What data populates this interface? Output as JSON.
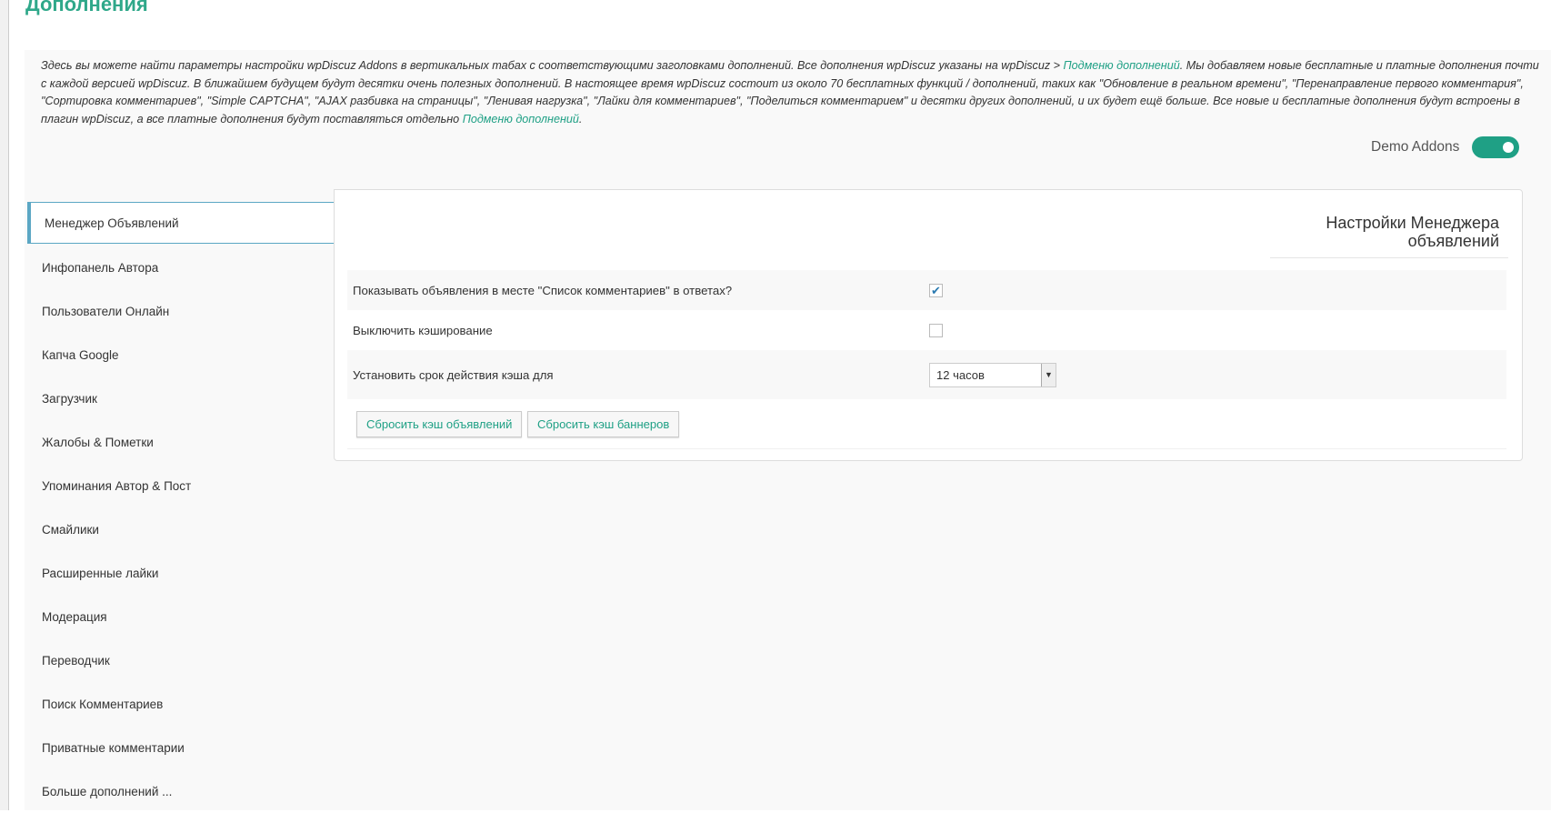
{
  "page_title": "Дополнения",
  "intro": {
    "part1": "Здесь вы можете найти параметры настройки wpDiscuz Addons в вертикальных табах с соответствующими заголовками дополнений. Все дополнения wpDiscuz указаны на wpDiscuz > ",
    "link1": "Подменю дополнений",
    "part2": ". Мы добавляем новые бесплатные и платные дополнения почти с каждой версией wpDiscuz. В ближайшем будущем будут десятки очень полезных дополнений. В настоящее время wpDiscuz состоит из около 70 бесплатных функций / дополнений, таких как \"Обновление в реальном времени\", \"Перенаправление первого комментария\", \"Сортировка комментариев\", \"Simple CAPTCHA\", \"AJAX разбивка на страницы\", \"Ленивая нагрузка\", \"Лайки для комментариев\", \"Поделиться комментарием\" и десятки других дополнений, и их будет ещё больше. Все новые и бесплатные дополнения будут встроены в плагин wpDiscuz, а все платные дополнения будут поставляться отдельно ",
    "link2": "Подменю дополнений",
    "part3": "."
  },
  "demo_addons": {
    "label": "Demo Addons",
    "enabled": true
  },
  "sidebar": {
    "items": [
      {
        "label": "Менеджер Объявлений"
      },
      {
        "label": "Инфопанель Автора"
      },
      {
        "label": "Пользователи Онлайн"
      },
      {
        "label": "Капча Google"
      },
      {
        "label": "Загрузчик"
      },
      {
        "label": "Жалобы & Пометки"
      },
      {
        "label": "Упоминания Автор & Пост"
      },
      {
        "label": "Смайлики"
      },
      {
        "label": "Расширенные лайки"
      },
      {
        "label": "Модерация"
      },
      {
        "label": "Переводчик"
      },
      {
        "label": "Поиск Комментариев"
      },
      {
        "label": "Приватные комментарии"
      },
      {
        "label": "Больше дополнений ..."
      }
    ]
  },
  "panel": {
    "heading": "Настройки Менеджера объявлений",
    "settings": [
      {
        "label": "Показывать объявления в месте \"Список комментариев\" в ответах?",
        "checked": true
      },
      {
        "label": "Выключить кэширование",
        "checked": false
      },
      {
        "label": "Установить срок действия кэша для",
        "value": "12 часов"
      }
    ],
    "buttons": {
      "reset_ads": "Сбросить кэш объявлений",
      "reset_banners": "Сбросить кэш баннеров"
    }
  },
  "colors": {
    "accent": "#1fa085",
    "active_tab_border": "#5ba7c4"
  }
}
